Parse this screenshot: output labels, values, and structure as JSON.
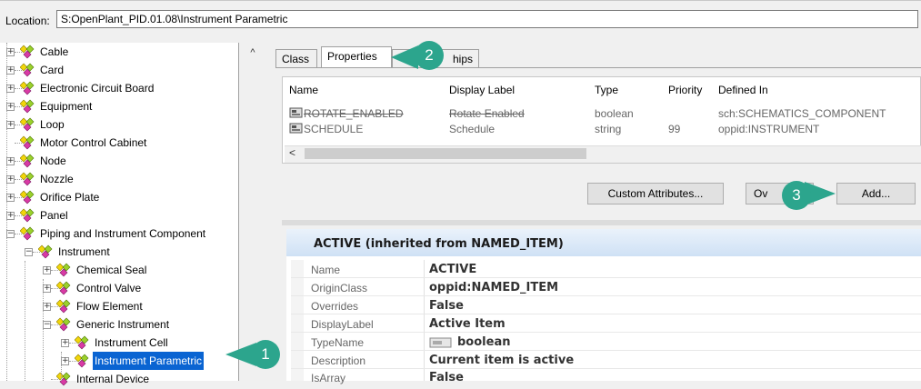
{
  "location": {
    "label": "Location:",
    "value": "S:OpenPlant_PID.01.08\\Instrument Parametric"
  },
  "tree": {
    "items": [
      {
        "label": "Cable"
      },
      {
        "label": "Card"
      },
      {
        "label": "Electronic Circuit Board"
      },
      {
        "label": "Equipment"
      },
      {
        "label": "Loop"
      },
      {
        "label": "Motor Control Cabinet"
      },
      {
        "label": "Node"
      },
      {
        "label": "Nozzle"
      },
      {
        "label": "Orifice Plate"
      },
      {
        "label": "Panel"
      },
      {
        "label": "Piping and Instrument Component"
      },
      {
        "label": "Instrument"
      },
      {
        "label": "Chemical Seal"
      },
      {
        "label": "Control Valve"
      },
      {
        "label": "Flow Element"
      },
      {
        "label": "Generic Instrument"
      },
      {
        "label": "Instrument Cell"
      },
      {
        "label": "Instrument Parametric"
      },
      {
        "label": "Internal Device"
      }
    ],
    "scroll_up": "^"
  },
  "tabs": [
    {
      "label": "Class"
    },
    {
      "label": "Properties"
    },
    {
      "label": "hips"
    }
  ],
  "property_list": {
    "columns": [
      "Name",
      "Display Label",
      "Type",
      "Priority",
      "Defined In"
    ],
    "rows": [
      {
        "name": "ROTATE_ENABLED",
        "display": "Rotate Enabled",
        "type": "boolean",
        "priority": "",
        "defined_in": "sch:SCHEMATICS_COMPONENT"
      },
      {
        "name": "SCHEDULE",
        "display": "Schedule",
        "type": "string",
        "priority": "99",
        "defined_in": "oppid:INSTRUMENT"
      }
    ],
    "scroll_left": "<"
  },
  "buttons": {
    "custom_attributes": "Custom Attributes...",
    "override": "Ov",
    "add": "Add..."
  },
  "detail": {
    "title": "ACTIVE (inherited from NAMED_ITEM)",
    "rows": [
      {
        "label": "Name",
        "value": "ACTIVE"
      },
      {
        "label": "OriginClass",
        "value": "oppid:NAMED_ITEM"
      },
      {
        "label": "Overrides",
        "value": "False"
      },
      {
        "label": "DisplayLabel",
        "value": "Active Item"
      },
      {
        "label": "TypeName",
        "value": "boolean"
      },
      {
        "label": "Description",
        "value": "Current item is active"
      },
      {
        "label": "IsArray",
        "value": "False"
      }
    ]
  },
  "callouts": [
    "1",
    "2",
    "3"
  ],
  "colors": {
    "callout": "#2ca58d",
    "selection": "#0a64d2",
    "header_gradient_top": "#eaf2fb"
  }
}
